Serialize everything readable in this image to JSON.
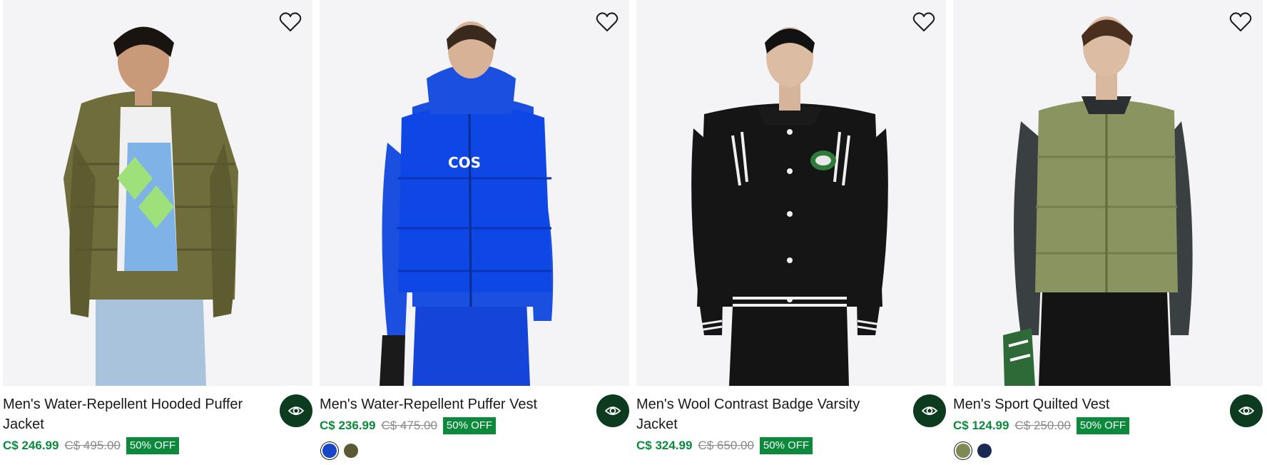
{
  "products": [
    {
      "title": "Men's Water-Repellent Hooded Puffer Jacket",
      "sale_price": "C$ 246.99",
      "original_price": "C$ 495.00",
      "discount": "50% OFF",
      "image": "olive-hooded-puffer-jacket",
      "swatches": []
    },
    {
      "title": "Men's Water-Repellent Puffer Vest",
      "sale_price": "C$ 236.99",
      "original_price": "C$ 475.00",
      "discount": "50% OFF",
      "image": "blue-puffer-vest",
      "swatches": [
        "#1846c8",
        "#5c5a34"
      ]
    },
    {
      "title": "Men's Wool Contrast Badge Varsity Jacket",
      "sale_price": "C$ 324.99",
      "original_price": "C$ 650.00",
      "discount": "50% OFF",
      "image": "black-varsity-jacket",
      "swatches": []
    },
    {
      "title": "Men's Sport Quilted Vest",
      "sale_price": "C$ 124.99",
      "original_price": "C$ 250.00",
      "discount": "50% OFF",
      "image": "khaki-quilted-vest",
      "swatches": [
        "#7d8a52",
        "#1b2a55"
      ]
    }
  ],
  "colors": {
    "sale": "#0a8a3a",
    "badge_bg": "#0a8a3a",
    "quick_view_bg": "#0d3b1f",
    "original": "#8a8a8a"
  },
  "icons": {
    "wishlist": "heart-outline-icon",
    "quick_view": "eye-icon"
  }
}
